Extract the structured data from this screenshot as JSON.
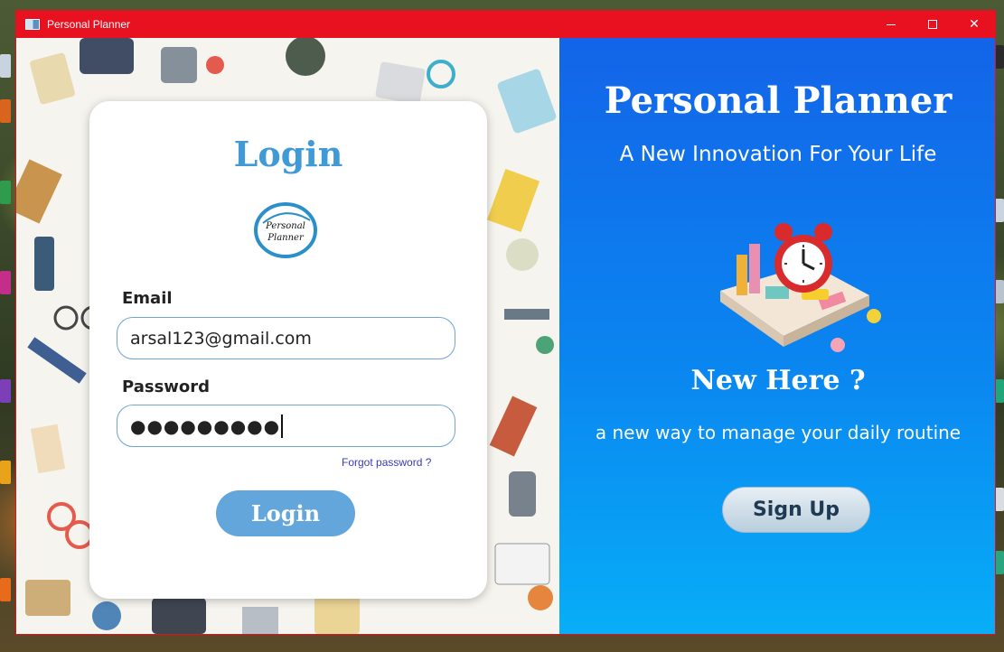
{
  "window": {
    "title": "Personal Planner",
    "controls": {
      "minimize": "minimize",
      "maximize": "maximize",
      "close": "✕"
    }
  },
  "login_card": {
    "title": "Login",
    "email_label": "Email",
    "email_value": "arsal123@gmail.com",
    "password_label": "Password",
    "password_value": "●●●●●●●●●",
    "forgot_link": "Forgot password ?",
    "login_button": "Login"
  },
  "side_panel": {
    "title": "Personal Planner",
    "subtitle": "A New Innovation For Your Life",
    "new_here": "New Here ?",
    "tagline": "a new way to manage your daily routine",
    "signup_button": "Sign Up"
  },
  "colors": {
    "titlebar": "#e8111f",
    "accent": "#3f9ad6",
    "login_button": "#63a6dc",
    "panel_top": "#1364e8",
    "panel_bottom": "#08aef7"
  },
  "icons": {
    "app": "window-app-icon",
    "logo": "personal-planner-logo",
    "illustration": "alarm-clock-desk-illustration"
  }
}
